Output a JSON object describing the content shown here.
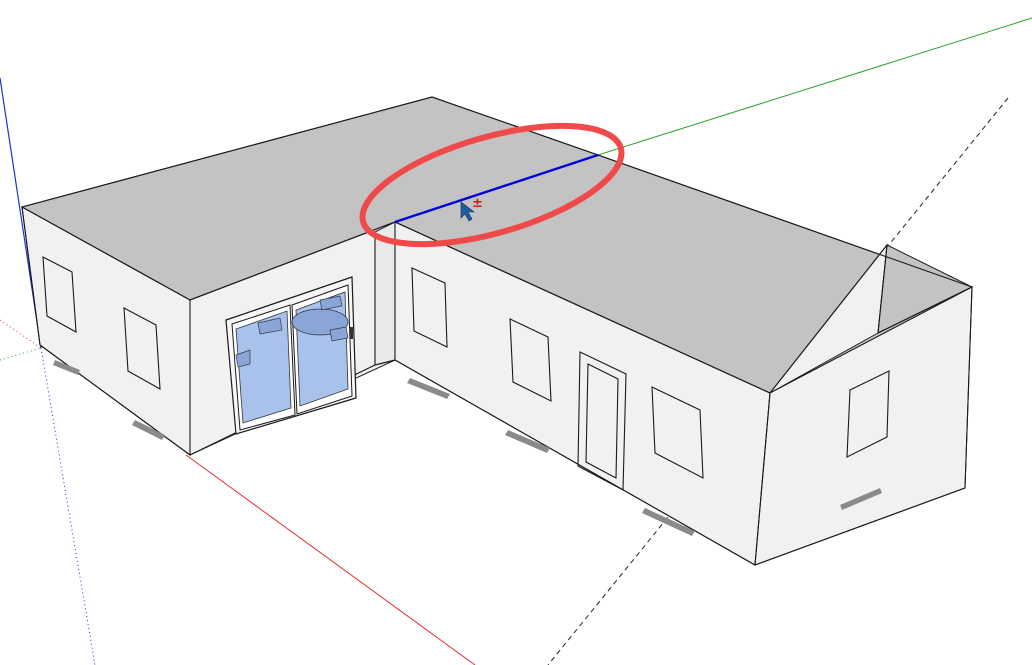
{
  "app": {
    "view": "3d-modeling-viewport"
  },
  "colors": {
    "background": "#ffffff",
    "roof": "#c3c3c3",
    "wall": "#f1f1f1",
    "wall_shade": "#e9e9e9",
    "edge": "#1a1a1a",
    "axis_red": "#e03030",
    "axis_green": "#2aa02a",
    "axis_blue": "#2233cc",
    "selected_edge": "#0000dd",
    "highlight_ellipse": "#f0494a",
    "glass": "#a9c2ec",
    "inference_marker": "#d01818",
    "cursor": "#1f5fa0"
  },
  "icons": {
    "cursor": "move-cursor-icon",
    "inference": "plus-minus-marker-icon"
  },
  "cursor_marker_text": "±",
  "elements": {
    "selected_edge": "roof-ridge-edge",
    "highlight": "red-ellipse-callout"
  }
}
